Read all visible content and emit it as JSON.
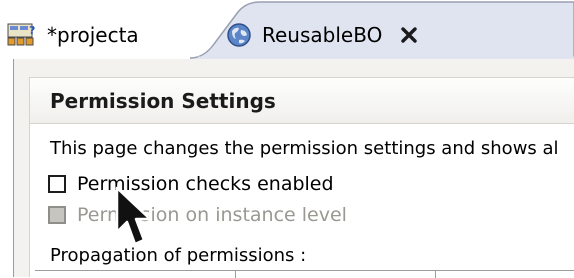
{
  "tabs": [
    {
      "label": "*projecta",
      "icon": "project-icon",
      "active": false
    },
    {
      "label": "ReusableBO",
      "icon": "globe-icon",
      "active": true
    }
  ],
  "section": {
    "title": "Permission Settings",
    "description": "This page changes the permission settings and shows al",
    "checkboxes": [
      {
        "label": "Permission checks enabled",
        "checked": false,
        "enabled": true
      },
      {
        "label": "Permission on instance level",
        "checked": false,
        "enabled": false
      }
    ],
    "propagation_label": "Propagation of permissions :"
  },
  "colors": {
    "editor_bg": "#f3f2ee",
    "active_tab": "#dfe4f0",
    "disabled_text": "#9a9892"
  }
}
